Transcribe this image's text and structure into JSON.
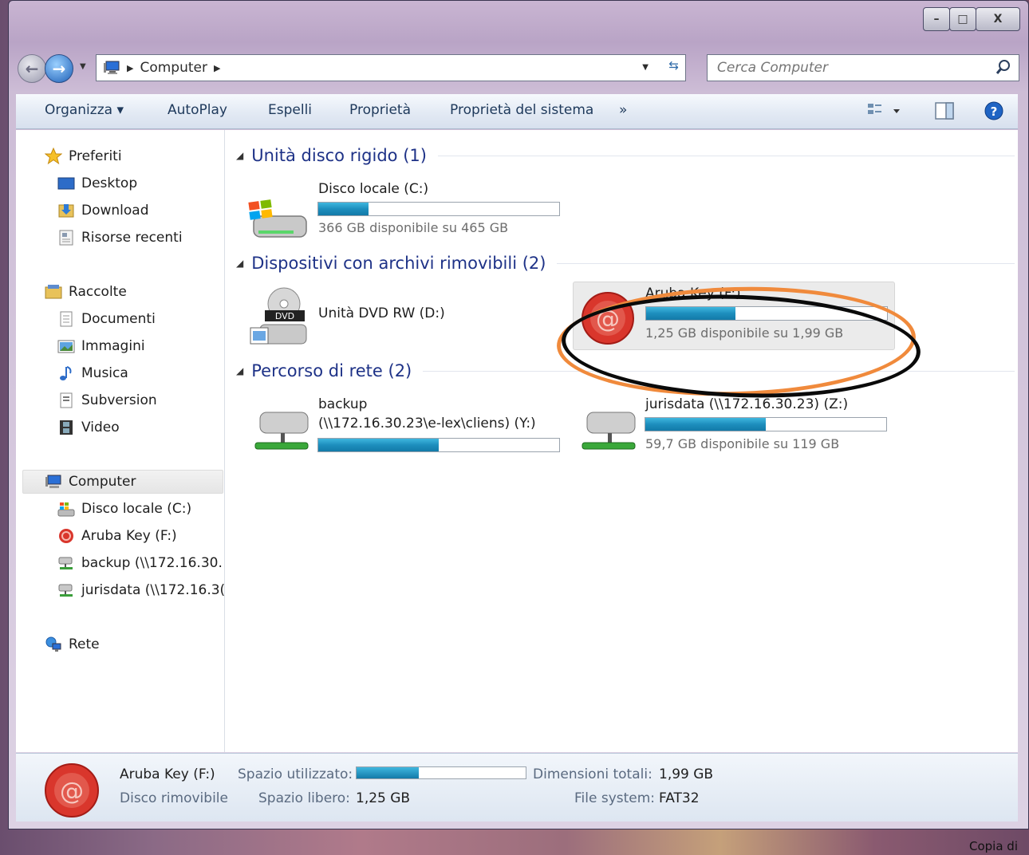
{
  "window": {
    "caption_buttons": {
      "minimize": "–",
      "maximize": "□",
      "close": "X"
    }
  },
  "address": {
    "path_label": "Computer",
    "search_placeholder": "Cerca Computer"
  },
  "toolbar": {
    "organize": "Organizza ▾",
    "autoplay": "AutoPlay",
    "eject": "Espelli",
    "properties": "Proprietà",
    "system_properties": "Proprietà del sistema",
    "more": "»"
  },
  "nav": {
    "favorites": "Preferiti",
    "desktop": "Desktop",
    "download": "Download",
    "recent": "Risorse recenti",
    "libraries": "Raccolte",
    "documents": "Documenti",
    "images": "Immagini",
    "music": "Musica",
    "subversion": "Subversion",
    "video": "Video",
    "computer": "Computer",
    "local_disk": "Disco locale (C:)",
    "aruba": "Aruba Key (F:)",
    "backup": "backup (\\\\172.16.30.",
    "jurisdata": "jurisdata (\\\\172.16.3(",
    "network": "Rete"
  },
  "groups": {
    "hard_disks": "Unità disco rigido (1)",
    "removable": "Dispositivi con archivi rimovibili (2)",
    "network": "Percorso di rete (2)"
  },
  "drives": {
    "c": {
      "name": "Disco locale (C:)",
      "info": "366 GB disponibile su 465 GB",
      "used_fraction": 0.21
    },
    "dvd": {
      "name": "Unità DVD RW (D:)",
      "badge": "DVD"
    },
    "aruba": {
      "name": "Aruba Key (F:)",
      "info": "1,25 GB disponibile su 1,99 GB",
      "used_fraction": 0.37
    },
    "backup": {
      "name_line1": "backup",
      "name_line2": "(\\\\172.16.30.23\\e-lex\\cliens) (Y:)",
      "used_fraction": 0.5
    },
    "jurisdata": {
      "name": "jurisdata (\\\\172.16.30.23) (Z:)",
      "info": "59,7 GB disponibile su 119 GB",
      "used_fraction": 0.5
    }
  },
  "details": {
    "name": "Aruba Key (F:)",
    "type": "Disco rimovibile",
    "used_label": "Spazio utilizzato:",
    "used_fraction": 0.37,
    "free_label": "Spazio libero:",
    "free_value": "1,25 GB",
    "total_label": "Dimensioni totali:",
    "total_value": "1,99 GB",
    "fs_label": "File system:",
    "fs_value": "FAT32"
  },
  "taskbar": {
    "label": "Copia di"
  },
  "colors": {
    "accent": "#1e3287",
    "bar_fill": "#1d8ebd",
    "highlight_orange": "#f08a3c",
    "highlight_black": "#0a0a0a"
  }
}
